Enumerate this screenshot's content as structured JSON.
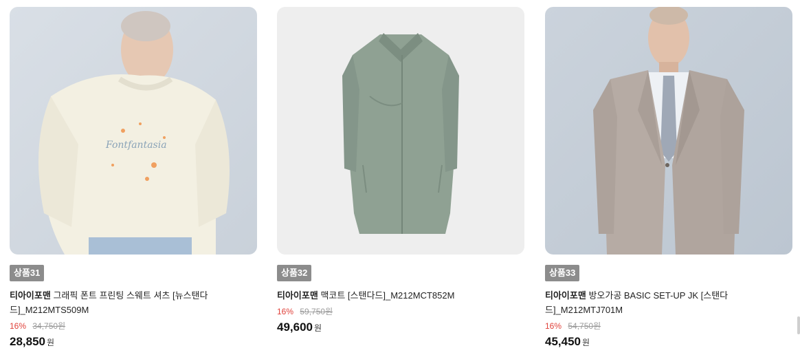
{
  "products": [
    {
      "badge": "상품31",
      "brand": "티아이포맨",
      "name": "그래픽 폰트 프린팅 스웨트 셔츠 [뉴스탠다드]_M212MTS509M",
      "discount_rate": "16%",
      "original_price": "34,750원",
      "price": "28,850",
      "currency": "원",
      "image_icon": "sweatshirt-model-photo"
    },
    {
      "badge": "상품32",
      "brand": "티아이포맨",
      "name": "맥코트 [스탠다드]_M212MCT852M",
      "discount_rate": "16%",
      "original_price": "59,750원",
      "price": "49,600",
      "currency": "원",
      "image_icon": "coat-product-photo"
    },
    {
      "badge": "상품33",
      "brand": "티아이포맨",
      "name": "방오가공 BASIC SET-UP JK [스탠다드]_M212MTJ701M",
      "discount_rate": "16%",
      "original_price": "54,750원",
      "price": "45,450",
      "currency": "원",
      "image_icon": "suit-model-photo"
    }
  ],
  "colors": {
    "badge_bg": "#8c8c8c",
    "discount": "#e0413a",
    "original_price": "#9a9a9a"
  }
}
